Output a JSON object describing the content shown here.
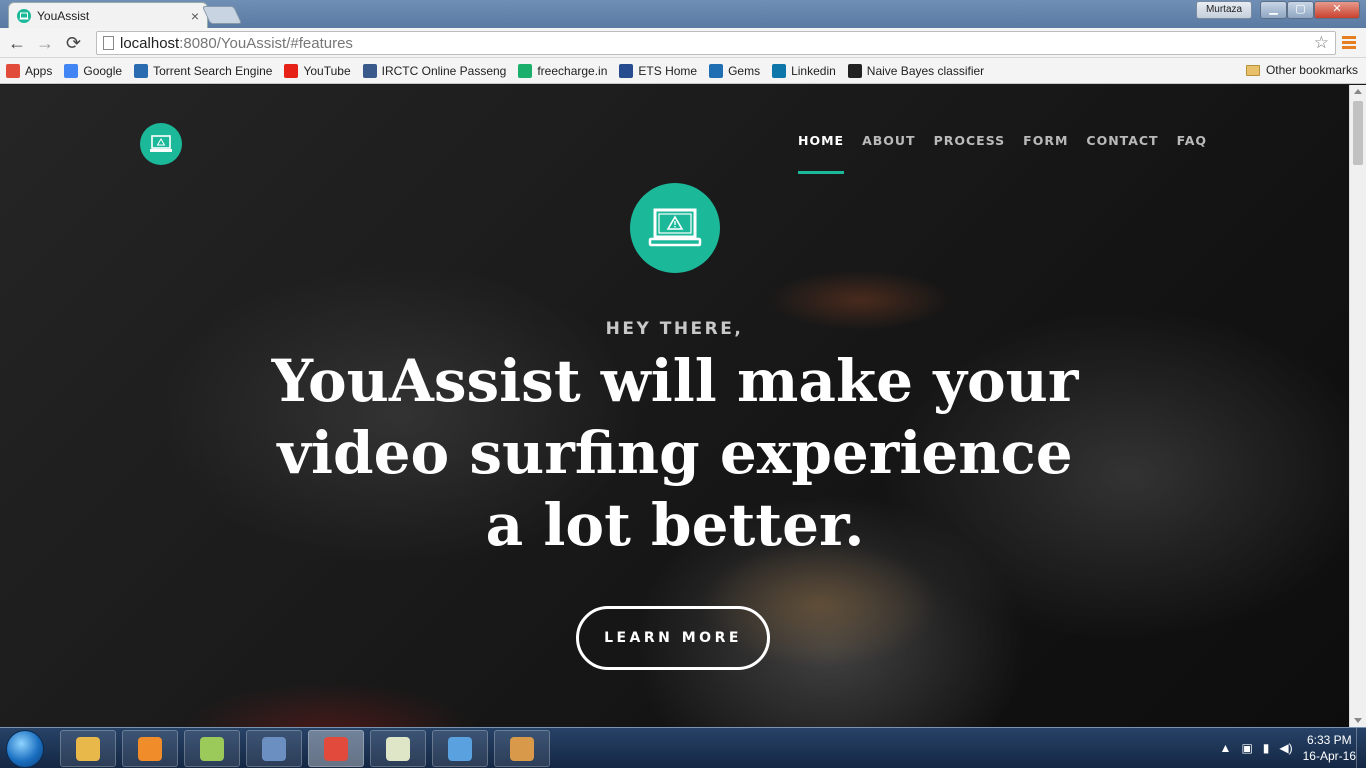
{
  "browser": {
    "tab_title": "YouAssist",
    "tab_close": "×",
    "user_name": "Murtaza",
    "window_buttons": {
      "minimize": "▁",
      "maximize": "▢",
      "close": "✕"
    },
    "nav": {
      "back": "←",
      "forward": "→",
      "reload": "⟳"
    },
    "url_host": "localhost",
    "url_rest": ":8080/YouAssist/#features",
    "star": "☆"
  },
  "bookmarks": {
    "items": [
      {
        "label": "Apps",
        "icon": "apps-grid-icon",
        "color": "#e04b3a"
      },
      {
        "label": "Google",
        "icon": "google-icon",
        "color": "#4285f4"
      },
      {
        "label": "Torrent Search Engine",
        "icon": "torrent-icon",
        "color": "#2b6cb0"
      },
      {
        "label": "YouTube",
        "icon": "youtube-icon",
        "color": "#e62117"
      },
      {
        "label": "IRCTC Online Passeng",
        "icon": "irctc-icon",
        "color": "#3a5a8c"
      },
      {
        "label": "freecharge.in",
        "icon": "freecharge-icon",
        "color": "#1aaf6a"
      },
      {
        "label": "ETS Home",
        "icon": "ets-icon",
        "color": "#264b8f"
      },
      {
        "label": "Gems",
        "icon": "gems-icon",
        "color": "#1f6fb2"
      },
      {
        "label": "Linkedin",
        "icon": "linkedin-icon",
        "color": "#0e76a8"
      },
      {
        "label": "Naive Bayes classifier",
        "icon": "wikipedia-icon",
        "color": "#222222"
      }
    ],
    "other": "Other bookmarks"
  },
  "site": {
    "nav": {
      "items": [
        {
          "label": "HOME",
          "active": true
        },
        {
          "label": "ABOUT"
        },
        {
          "label": "PROCESS"
        },
        {
          "label": "FORM"
        },
        {
          "label": "CONTACT"
        },
        {
          "label": "FAQ"
        }
      ]
    },
    "hero": {
      "eyebrow": "HEY THERE,",
      "headline": "YouAssist will make your video surfing experience a lot better.",
      "cta": "LEARN MORE"
    },
    "accent": "#1bb89a"
  },
  "taskbar": {
    "apps": [
      {
        "name": "file-explorer-icon",
        "color": "#e8b84a"
      },
      {
        "name": "media-player-icon",
        "color": "#f08c2a"
      },
      {
        "name": "sticky-notes-icon",
        "color": "#9bc95a"
      },
      {
        "name": "calculator-icon",
        "color": "#6a8fc0"
      },
      {
        "name": "chrome-icon",
        "color": "#e24a3b",
        "active": true
      },
      {
        "name": "tex-editor-icon",
        "color": "#dfe6c8"
      },
      {
        "name": "virtualbox-icon",
        "color": "#5aa1e0"
      },
      {
        "name": "paint-icon",
        "color": "#d89a4a"
      }
    ],
    "time": "6:33 PM",
    "date": "16-Apr-16"
  }
}
